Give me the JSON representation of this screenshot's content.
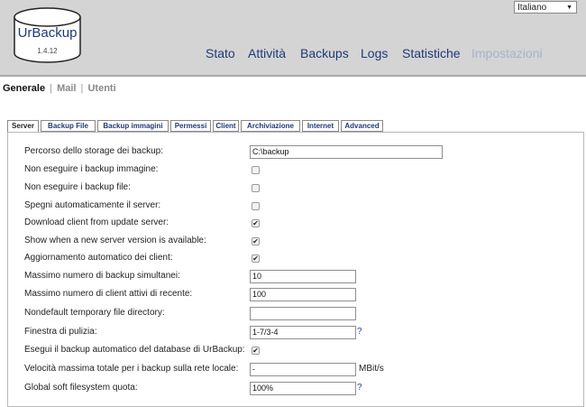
{
  "app": {
    "logo_text": "UrBackup",
    "version": "1.4.12"
  },
  "language": "Italiano",
  "nav": [
    {
      "label": "Stato"
    },
    {
      "label": "Attività"
    },
    {
      "label": "Backups"
    },
    {
      "label": "Logs"
    },
    {
      "label": "Statistiche"
    },
    {
      "label": "Impostazioni"
    }
  ],
  "subnav": {
    "current": "Generale",
    "links": [
      "Mail",
      "Utenti"
    ]
  },
  "tabs": [
    {
      "label": "Server"
    },
    {
      "label": "Backup File"
    },
    {
      "label": "Backup immagini"
    },
    {
      "label": "Permessi"
    },
    {
      "label": "Client"
    },
    {
      "label": "Archiviazione"
    },
    {
      "label": "Internet"
    },
    {
      "label": "Advanced"
    }
  ],
  "settings": {
    "storage_path": {
      "label": "Percorso dello storage dei backup:",
      "value": "C:\\backup"
    },
    "no_image_backups": {
      "label": "Non eseguire i backup immagine:",
      "checked": false
    },
    "no_file_backups": {
      "label": "Non eseguire i backup file:",
      "checked": false
    },
    "autoshutdown": {
      "label": "Spegni automaticamente il server:",
      "checked": false
    },
    "download_client": {
      "label": "Download client from update server:",
      "checked": true
    },
    "show_new_version": {
      "label": "Show when a new server version is available:",
      "checked": true
    },
    "autoupdate_clients": {
      "label": "Aggiornamento automatico dei client:",
      "checked": true
    },
    "max_simultaneous": {
      "label": "Massimo numero di backup simultanei:",
      "value": "10"
    },
    "max_active_clients": {
      "label": "Massimo numero di client attivi di recente:",
      "value": "100"
    },
    "tmpdir": {
      "label": "Nondefault temporary file directory:",
      "value": ""
    },
    "cleanup_window": {
      "label": "Finestra di pulizia:",
      "value": "1-7/3-4",
      "help": "?"
    },
    "backup_database": {
      "label": "Esegui il backup automatico del database di UrBackup:",
      "checked": true
    },
    "global_speed": {
      "label": "Velocità massima totale per i backup sulla rete locale:",
      "value": "-",
      "unit": "MBit/s"
    },
    "soft_quota": {
      "label": "Global soft filesystem quota:",
      "value": "100%",
      "help": "?"
    }
  }
}
